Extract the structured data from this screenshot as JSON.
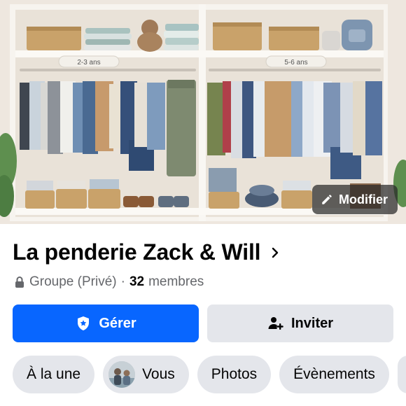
{
  "cover": {
    "shelf_labels": [
      "2-3 ans",
      "5-6 ans"
    ],
    "edit_label": "Modifier",
    "edit_icon": "pencil-icon"
  },
  "group": {
    "name": "La penderie Zack & Will",
    "name_chevron_icon": "chevron-right-icon",
    "privacy_icon": "lock-icon",
    "privacy": "Groupe (Privé)",
    "separator": "·",
    "member_count": "32",
    "members_word": "membres"
  },
  "actions": {
    "manage": {
      "label": "Gérer",
      "icon": "shield-star-icon"
    },
    "invite": {
      "label": "Inviter",
      "icon": "add-person-icon"
    }
  },
  "tabs": [
    {
      "label": "À la une"
    },
    {
      "label": "Vous",
      "avatar": "user-avatar"
    },
    {
      "label": "Photos"
    },
    {
      "label": "Évènements"
    }
  ],
  "colors": {
    "primary": "#0866ff",
    "secondary_bg": "#e4e6eb",
    "text": "#050505",
    "muted_text": "#65676b"
  }
}
